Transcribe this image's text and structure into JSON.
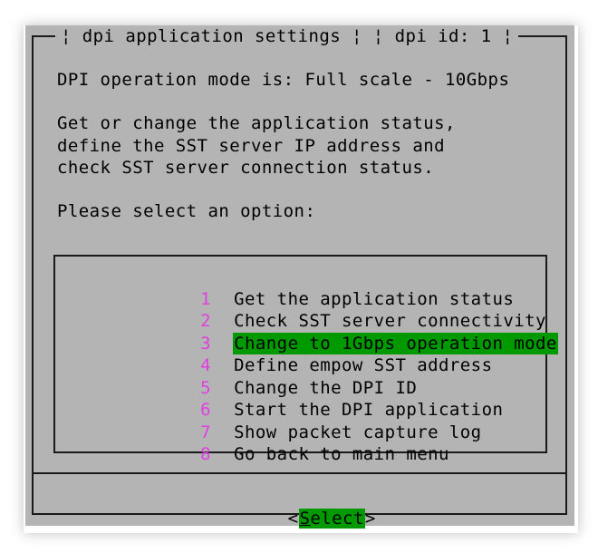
{
  "dialog": {
    "title_left": "¦ dpi application settings ¦",
    "title_right": "¦ dpi id: 1 ¦",
    "mode_line": "DPI operation mode is: Full scale - 10Gbps",
    "description": [
      "Get or change the application status,",
      "define the SST server IP address and",
      "check SST server connection status."
    ],
    "prompt": "Please select an option:"
  },
  "menu": {
    "selected_index": 2,
    "items": [
      {
        "tag": "1",
        "label": "Get the application status"
      },
      {
        "tag": "2",
        "label": "Check SST server connectivity"
      },
      {
        "tag": "3",
        "label": "Change to 1Gbps operation mode"
      },
      {
        "tag": "4",
        "label": "Define empow SST address"
      },
      {
        "tag": "5",
        "label": "Change the DPI ID"
      },
      {
        "tag": "6",
        "label": "Start the DPI application"
      },
      {
        "tag": "7",
        "label": "Show packet capture log"
      },
      {
        "tag": "8",
        "label": "Go back to main menu"
      }
    ]
  },
  "buttons": {
    "select": {
      "open": "<",
      "hotkey": "S",
      "rest": "elect",
      "close": ">"
    }
  },
  "colors": {
    "background": "#b4b4b4",
    "highlight": "#009a00",
    "tag": "#e040e0"
  }
}
